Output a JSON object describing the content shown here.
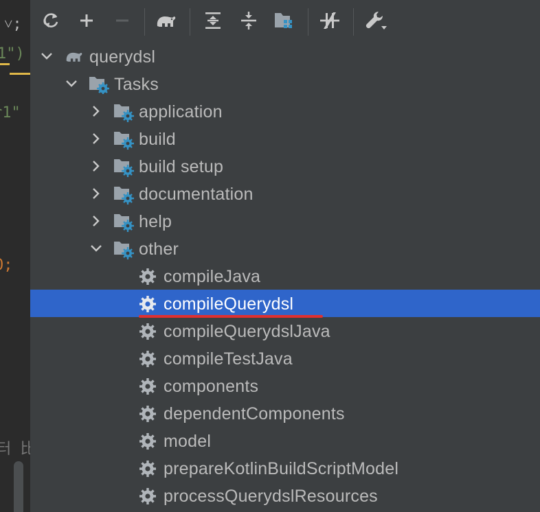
{
  "editor": {
    "frag_a": "˅;",
    "frag_b": "1\")",
    "frag_c": "r1\"",
    "frag_d": "0;",
    "frag_e": "터 比"
  },
  "toolbar": {
    "buttons": [
      {
        "name": "refresh-icon"
      },
      {
        "name": "add-icon"
      },
      {
        "name": "remove-icon"
      },
      {
        "name": "gradle-elephant-icon"
      },
      {
        "name": "expand-all-icon"
      },
      {
        "name": "collapse-all-icon"
      },
      {
        "name": "group-modules-icon"
      },
      {
        "name": "toggle-offline-icon"
      },
      {
        "name": "settings-wrench-icon"
      }
    ]
  },
  "tree": {
    "root": {
      "label": "querydsl",
      "icon": "gradle-elephant-icon"
    },
    "tasks": {
      "label": "Tasks",
      "icon": "folder-gear-icon"
    },
    "groups": [
      {
        "label": "application"
      },
      {
        "label": "build"
      },
      {
        "label": "build setup"
      },
      {
        "label": "documentation"
      },
      {
        "label": "help"
      },
      {
        "label": "other"
      }
    ],
    "other_items": [
      {
        "label": "compileJava"
      },
      {
        "label": "compileQuerydsl",
        "selected": true
      },
      {
        "label": "compileQuerydslJava"
      },
      {
        "label": "compileTestJava"
      },
      {
        "label": "components"
      },
      {
        "label": "dependentComponents"
      },
      {
        "label": "model"
      },
      {
        "label": "prepareKotlinBuildScriptModel"
      },
      {
        "label": "processQuerydslResources"
      }
    ]
  },
  "colors": {
    "panel_bg": "#3c3f41",
    "selection": "#2f65ca",
    "folder_gear_accent": "#3592c4",
    "annotation_underline": "#e03030"
  }
}
